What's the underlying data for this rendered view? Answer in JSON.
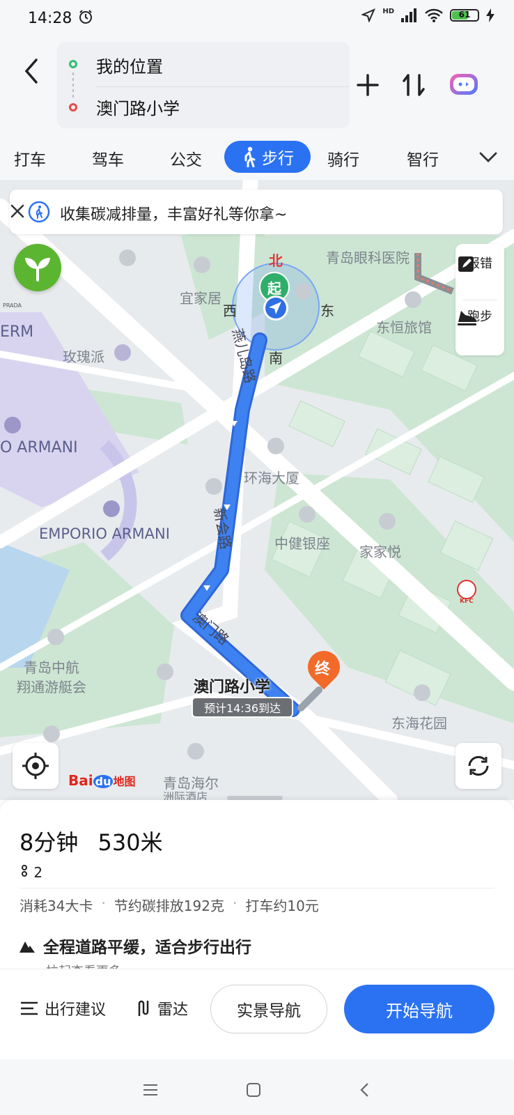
{
  "status_bar": {
    "time": "14:28",
    "network": "HD",
    "battery": "61",
    "battery_level": 0.61
  },
  "route": {
    "start": "我的位置",
    "end": "澳门路小学"
  },
  "modes": {
    "items": [
      "打车",
      "驾车",
      "公交",
      "步行",
      "骑行",
      "智行"
    ],
    "active": "步行"
  },
  "banner": {
    "text": "收集碳减排量，丰富好礼等你拿~"
  },
  "side_panel": {
    "report": "报错",
    "run": "跑步"
  },
  "compass": {
    "north": "北",
    "west": "西",
    "east": "东",
    "south": "南",
    "start": "起"
  },
  "map_labels": {
    "hospital": "青岛眼科医院",
    "yijia": "宜家居",
    "hengdong": "东恒旅馆",
    "rose": "玫瑰派",
    "erm": "ERM",
    "armani1": "O ARMANI",
    "armani2": "EMPORIO ARMANI",
    "huanhai": "环海大厦",
    "zhongjian": "中健银座",
    "jiajiayue": "家家悦",
    "zhonghang1": "青岛中航",
    "zhonghang2": "翔通游艇会",
    "donghai": "东海花园",
    "haier": "青岛海尔",
    "haier2": "洲际酒店",
    "yanerlu": "燕儿岛路",
    "xinhuilu": "新会路",
    "aomenlu": "澳门路",
    "destination": "澳门路小学",
    "end_marker": "终",
    "eta": "预计14:36到达",
    "prada": "PRADA",
    "kfc": "KFC",
    "logo_bai": "Bai",
    "logo_du": "du",
    "logo_map": "地图"
  },
  "summary": {
    "time": "8分钟",
    "distance": "530米",
    "step_count": "2",
    "calories": "消耗34大卡",
    "carbon": "节约碳排放192克",
    "taxi": "打车约10元"
  },
  "tip": {
    "title": "全程道路平缓，适合步行出行",
    "more": "拉起查看更多"
  },
  "bottom_bar": {
    "advice": "出行建议",
    "radar": "雷达",
    "ar_nav": "实景导航",
    "start_nav": "开始导航"
  },
  "colors": {
    "accent": "#2b72f2",
    "route": "#3d82f0",
    "leaf": "#5cb531",
    "end": "#f26a2a"
  }
}
